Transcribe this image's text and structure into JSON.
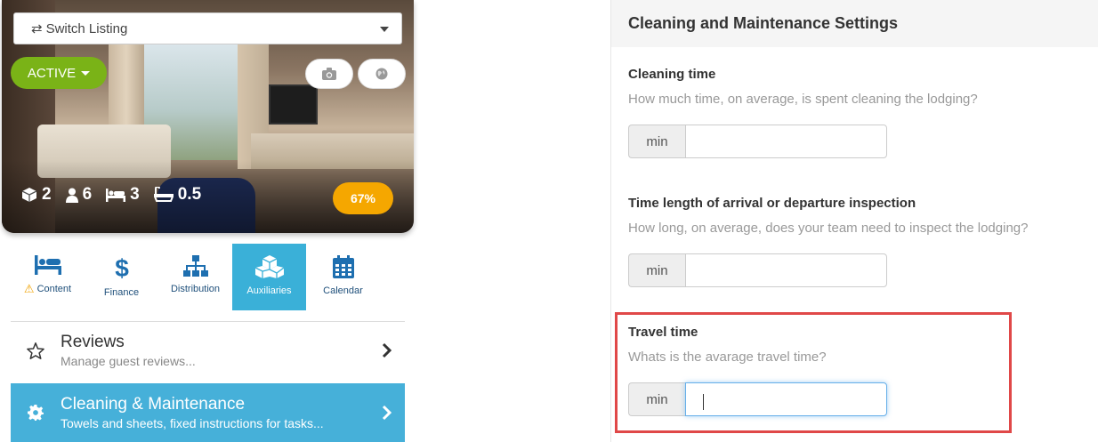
{
  "listing": {
    "switch_label": "Switch Listing",
    "status_label": "ACTIVE",
    "stats": {
      "rooms": "2",
      "guests": "6",
      "beds": "3",
      "baths": "0.5"
    },
    "completion": "67%"
  },
  "tabs": [
    {
      "label": "Content",
      "warning": true
    },
    {
      "label": "Finance"
    },
    {
      "label": "Distribution"
    },
    {
      "label": "Auxiliaries",
      "active": true
    },
    {
      "label": "Calendar"
    }
  ],
  "menu": {
    "reviews": {
      "title": "Reviews",
      "subtitle": "Manage guest reviews..."
    },
    "cleaning": {
      "title": "Cleaning & Maintenance",
      "subtitle": "Towels and sheets, fixed instructions for tasks..."
    }
  },
  "settings": {
    "header": "Cleaning and Maintenance Settings",
    "cleaning_time": {
      "label": "Cleaning time",
      "help": "How much time, on average, is spent cleaning the lodging?",
      "unit": "min",
      "value": ""
    },
    "inspection_time": {
      "label": "Time length of arrival or departure inspection",
      "help": "How long, on average, does your team need to inspect the lodging?",
      "unit": "min",
      "value": ""
    },
    "travel_time": {
      "label": "Travel time",
      "help": "Whats is the avarage travel time?",
      "unit": "min",
      "value": ""
    }
  },
  "colors": {
    "active_green": "#7ab317",
    "accent_blue": "#46b0d9",
    "percent_orange": "#f5a700",
    "highlight_red": "#e04848"
  }
}
